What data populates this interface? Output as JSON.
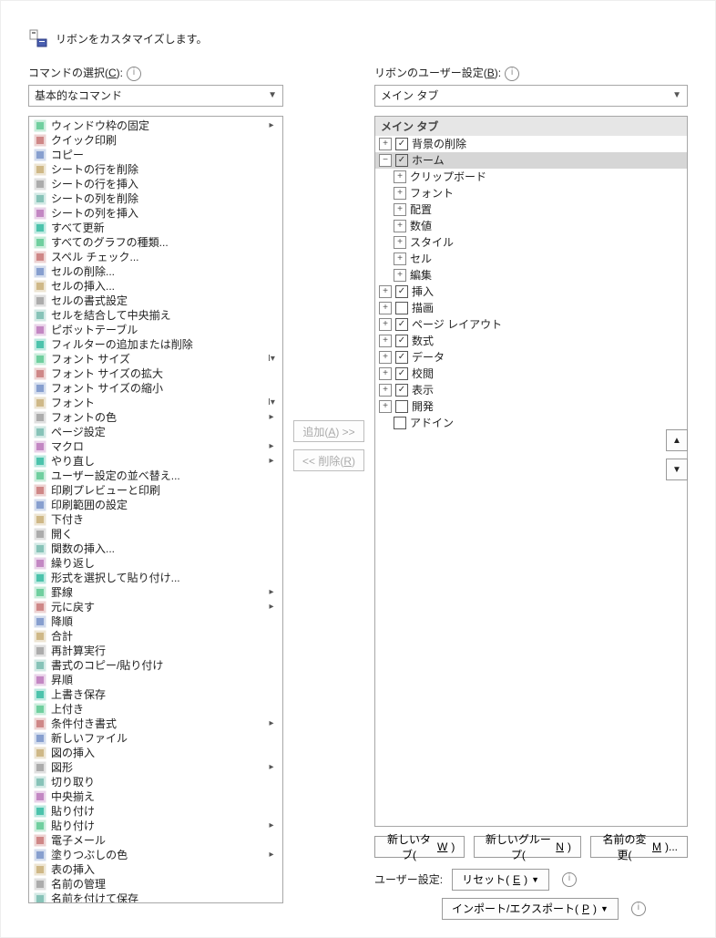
{
  "header": {
    "title": "リボンをカスタマイズします。"
  },
  "left": {
    "label_prefix": "コマンドの選択(",
    "label_key": "C",
    "label_suffix": "):",
    "dropdown": "基本的なコマンド",
    "commands": [
      {
        "label": "ウィンドウ枠の固定",
        "ext": "▸"
      },
      {
        "label": "クイック印刷"
      },
      {
        "label": "コピー"
      },
      {
        "label": "シートの行を削除"
      },
      {
        "label": "シートの行を挿入"
      },
      {
        "label": "シートの列を削除"
      },
      {
        "label": "シートの列を挿入"
      },
      {
        "label": "すべて更新"
      },
      {
        "label": "すべてのグラフの種類..."
      },
      {
        "label": "スペル チェック..."
      },
      {
        "label": "セルの削除..."
      },
      {
        "label": "セルの挿入..."
      },
      {
        "label": "セルの書式設定"
      },
      {
        "label": "セルを結合して中央揃え"
      },
      {
        "label": "ピボットテーブル"
      },
      {
        "label": "フィルターの追加または削除"
      },
      {
        "label": "フォント サイズ",
        "ext": "I▾"
      },
      {
        "label": "フォント サイズの拡大"
      },
      {
        "label": "フォント サイズの縮小"
      },
      {
        "label": "フォント",
        "ext": "I▾"
      },
      {
        "label": "フォントの色",
        "ext": "▸"
      },
      {
        "label": "ページ設定"
      },
      {
        "label": "マクロ",
        "ext": "▸"
      },
      {
        "label": "やり直し",
        "ext": "▸"
      },
      {
        "label": "ユーザー設定の並べ替え..."
      },
      {
        "label": "印刷プレビューと印刷"
      },
      {
        "label": "印刷範囲の設定"
      },
      {
        "label": "下付き"
      },
      {
        "label": "開く"
      },
      {
        "label": "関数の挿入..."
      },
      {
        "label": "繰り返し"
      },
      {
        "label": "形式を選択して貼り付け..."
      },
      {
        "label": "罫線",
        "ext": "▸"
      },
      {
        "label": "元に戻す",
        "ext": "▸"
      },
      {
        "label": "降順"
      },
      {
        "label": "合計"
      },
      {
        "label": "再計算実行"
      },
      {
        "label": "書式のコピー/貼り付け"
      },
      {
        "label": "昇順"
      },
      {
        "label": "上書き保存"
      },
      {
        "label": "上付き"
      },
      {
        "label": "条件付き書式",
        "ext": "▸"
      },
      {
        "label": "新しいファイル"
      },
      {
        "label": "図の挿入"
      },
      {
        "label": "図形",
        "ext": "▸"
      },
      {
        "label": "切り取り"
      },
      {
        "label": "中央揃え"
      },
      {
        "label": "貼り付け"
      },
      {
        "label": "貼り付け",
        "ext": "▸"
      },
      {
        "label": "電子メール"
      },
      {
        "label": "塗りつぶしの色",
        "ext": "▸"
      },
      {
        "label": "表の挿入"
      },
      {
        "label": "名前の管理"
      },
      {
        "label": "名前を付けて保存"
      }
    ]
  },
  "mid": {
    "add_prefix": "追加(",
    "add_key": "A",
    "add_suffix": ") >>",
    "remove_prefix": "<< 削除(",
    "remove_key": "R",
    "remove_suffix": ")"
  },
  "right": {
    "label_prefix": "リボンのユーザー設定(",
    "label_key": "B",
    "label_suffix": "):",
    "dropdown": "メイン タブ",
    "tree_header": "メイン タブ",
    "nodes": {
      "bg_remove": "背景の削除",
      "home": "ホーム",
      "home_children": [
        "クリップボード",
        "フォント",
        "配置",
        "数値",
        "スタイル",
        "セル",
        "編集"
      ],
      "insert": "挿入",
      "draw": "描画",
      "page_layout": "ページ レイアウト",
      "formulas": "数式",
      "data": "データ",
      "review": "校閲",
      "view": "表示",
      "developer": "開発",
      "addin": "アドイン"
    },
    "new_tab_prefix": "新しいタブ(",
    "new_tab_key": "W",
    "new_tab_suffix": ")",
    "new_group_prefix": "新しいグループ(",
    "new_group_key": "N",
    "new_group_suffix": ")",
    "rename_prefix": "名前の変更(",
    "rename_key": "M",
    "rename_suffix": ")...",
    "user_setting_label": "ユーザー設定:",
    "reset_prefix": "リセット(",
    "reset_key": "E",
    "reset_suffix": ")",
    "import_prefix": "インポート/エクスポート(",
    "import_key": "P",
    "import_suffix": ")"
  }
}
